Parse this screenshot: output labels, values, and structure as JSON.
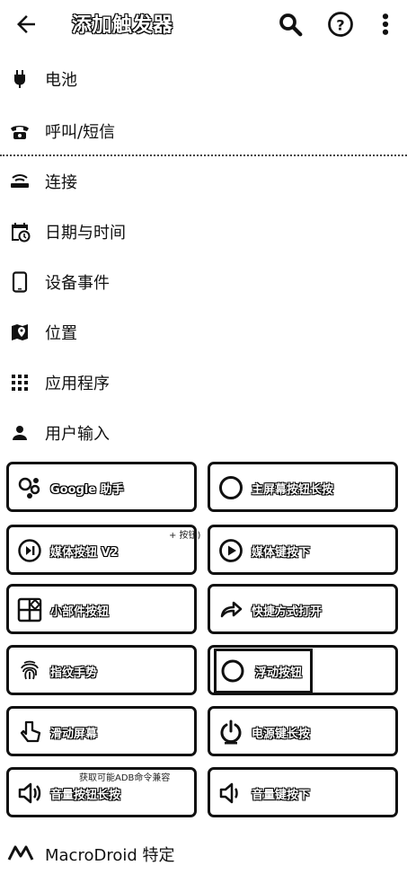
{
  "appbar": {
    "title": "添加触发器",
    "back_icon": "arrow-back-icon",
    "search_icon": "search-icon",
    "help_icon": "help-icon",
    "more_icon": "more-vert-icon"
  },
  "categories": [
    {
      "label": "电池",
      "icon": "power-plug-icon"
    },
    {
      "label": "呼叫/短信",
      "icon": "phone-icon"
    },
    {
      "label": "连接",
      "icon": "router-icon"
    },
    {
      "label": "日期与时间",
      "icon": "calendar-clock-icon"
    },
    {
      "label": "设备事件",
      "icon": "smartphone-icon"
    },
    {
      "label": "位置",
      "icon": "map-pin-icon"
    },
    {
      "label": "应用程序",
      "icon": "apps-grid-icon"
    },
    {
      "label": "用户输入",
      "icon": "person-icon"
    }
  ],
  "triggers": [
    {
      "label": "Google 助手",
      "icon": "assistant-icon"
    },
    {
      "label": "主屏幕按钮长按",
      "icon": "circle-icon"
    },
    {
      "label": "媒体按钮 V2",
      "icon": "media-play-pause-icon"
    },
    {
      "label": "媒体键按下",
      "icon": "play-circle-icon"
    },
    {
      "label": "小部件按钮",
      "icon": "widget-icon"
    },
    {
      "label": "快捷方式打开",
      "icon": "shortcut-arrow-icon"
    },
    {
      "label": "指纹手势",
      "icon": "fingerprint-icon"
    },
    {
      "label": "浮动按钮",
      "icon": "circle-icon"
    },
    {
      "label": "滑动屏幕",
      "icon": "touch-hand-icon"
    },
    {
      "label": "电源键长按",
      "icon": "power-icon"
    },
    {
      "label": "音量按钮长按",
      "icon": "volume-icon"
    },
    {
      "label": "音量键按下",
      "icon": "volume-icon"
    }
  ],
  "overlays": {
    "top_right_snip": "+ 按钮)",
    "volume_hint": "获取可能ADB命令兼容"
  },
  "footer": {
    "label": "MacroDroid 特定",
    "icon": "macrodroid-logo-icon"
  }
}
